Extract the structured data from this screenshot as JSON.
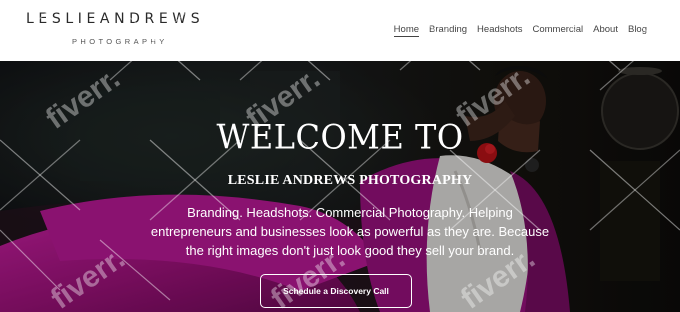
{
  "header": {
    "logo_name": "LESLIEANDREWS",
    "logo_sub": "PHOTOGRAPHY",
    "nav": [
      {
        "label": "Home",
        "active": true
      },
      {
        "label": "Branding",
        "active": false
      },
      {
        "label": "Headshots",
        "active": false
      },
      {
        "label": "Commercial",
        "active": false
      },
      {
        "label": "About",
        "active": false
      },
      {
        "label": "Blog",
        "active": false
      }
    ]
  },
  "hero": {
    "title": "WELCOME TO",
    "subtitle": "LESLIE ANDREWS PHOTOGRAPHY",
    "body": "Branding. Headshots. Commercial Photography. Helping entrepreneurs and businesses look as powerful as they are. Because the right images don't just look good they sell your brand.",
    "cta_label": "Schedule a Discovery Call",
    "image_subject": "woman-in-magenta-suit-reclining-portrait"
  },
  "watermark": {
    "text": "fiverr."
  },
  "colors": {
    "header_bg": "#ffffff",
    "nav_text": "#444444",
    "hero_text": "#ffffff",
    "suit_magenta": "#b3168f",
    "hero_dark": "#131316"
  }
}
